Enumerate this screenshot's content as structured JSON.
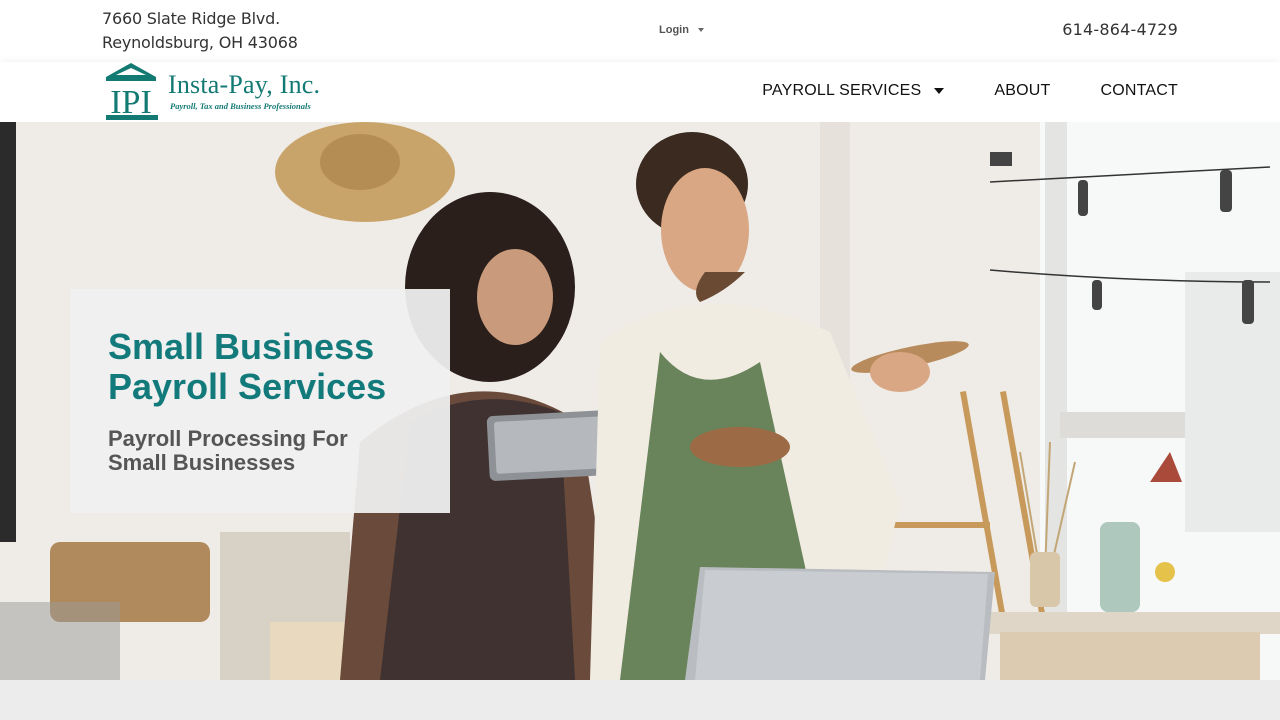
{
  "topbar": {
    "address_line1": "7660 Slate Ridge Blvd.",
    "address_line2": "Reynoldsburg, OH 43068",
    "login_label": "Login",
    "phone": "614-864-4729"
  },
  "brand": {
    "logo_mark_text": "IPI",
    "name": "Insta-Pay, Inc.",
    "tagline": "Payroll, Tax and Business Professionals",
    "color": "#137a73"
  },
  "nav": {
    "items": [
      {
        "label": "PAYROLL SERVICES",
        "has_dropdown": true
      },
      {
        "label": "ABOUT",
        "has_dropdown": false
      },
      {
        "label": "CONTACT",
        "has_dropdown": false
      }
    ]
  },
  "hero": {
    "title": "Small Business Payroll Services",
    "subtitle": "Payroll Processing For Small Businesses",
    "title_color": "#137a7b",
    "subtitle_color": "#555555"
  }
}
